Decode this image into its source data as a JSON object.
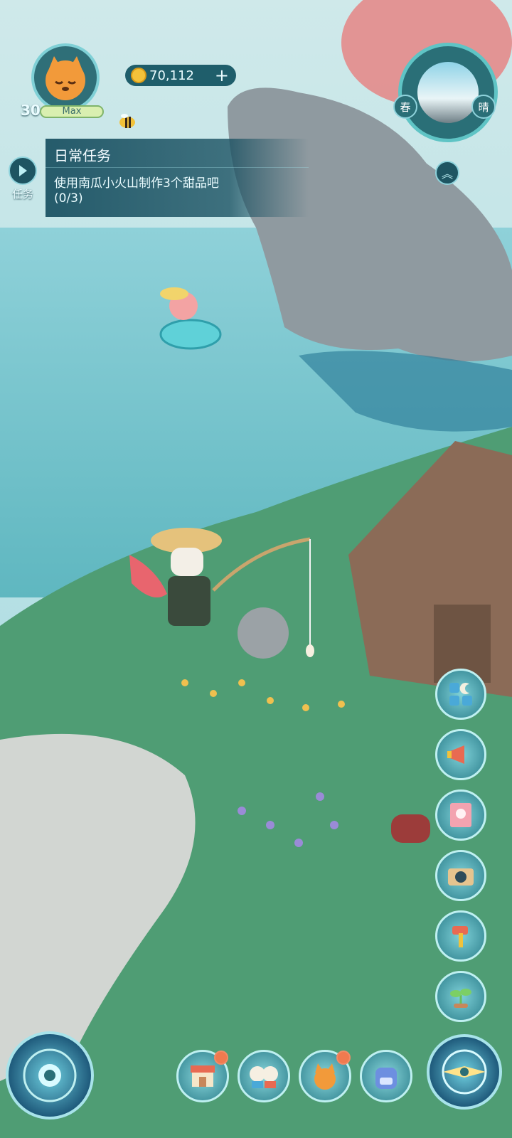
{
  "hud": {
    "level": "30",
    "level_label": "Max",
    "coins": "70,112",
    "coins_add": "+"
  },
  "task": {
    "toggle_label": "任务",
    "panel_title": "日常任务",
    "description": "使用南瓜小火山制作3个甜品吧",
    "progress": "(0/3)"
  },
  "season": {
    "season_label": "春",
    "weather_label": "晴"
  },
  "icons": {
    "avatar": "fox-face-icon",
    "coin": "gold-coin-icon",
    "bee": "bee-icon",
    "expand": "chevron-up-icon",
    "side": [
      "grid-moon-icon",
      "megaphone-icon",
      "flower-book-icon",
      "camera-icon",
      "hammer-icon",
      "sprout-icon"
    ],
    "bottom": [
      "shop-icon",
      "friends-icon",
      "fox-icon",
      "backpack-icon",
      "compass-icon",
      "moon-dial-icon"
    ]
  },
  "colors": {
    "accent": "#5fc4c5",
    "panel": "#174f60",
    "coin": "#f2c23a",
    "badge": "#f07a4f"
  }
}
